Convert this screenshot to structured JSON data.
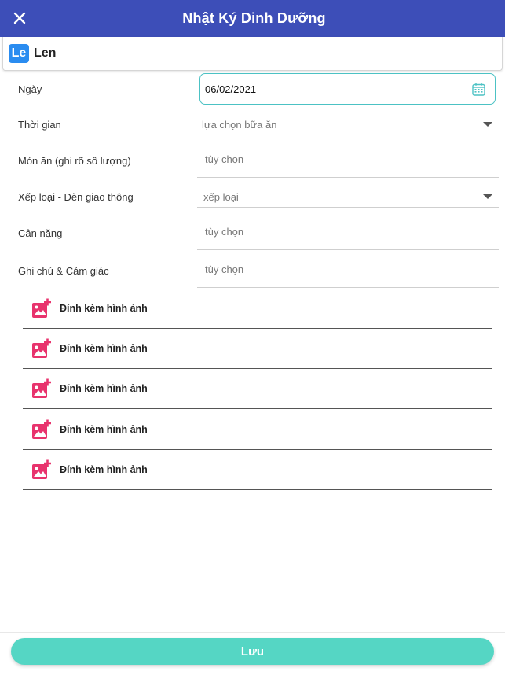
{
  "header": {
    "title": "Nhật Ký Dinh Dưỡng",
    "close_icon": "close-icon"
  },
  "profile": {
    "avatar_text": "Le",
    "name": "Len",
    "avatar_color": "#2a8cf0"
  },
  "form": {
    "date": {
      "label": "Ngày",
      "value": "06/02/2021",
      "icon": "calendar-icon"
    },
    "time": {
      "label": "Thời gian",
      "placeholder": "lựa chọn bữa ăn"
    },
    "food": {
      "label": "Món ăn (ghi rõ số lượng)",
      "placeholder": "tùy chọn"
    },
    "rating": {
      "label": "Xếp loại - Đèn giao thông",
      "placeholder": "xếp loại"
    },
    "weight": {
      "label": "Cân nặng",
      "placeholder": "tùy chọn"
    },
    "notes": {
      "label": "Ghi chú & Cảm giác",
      "placeholder": "tùy chọn"
    }
  },
  "attachments": [
    {
      "label": "Đính kèm hình ảnh",
      "icon": "add-photo-icon"
    },
    {
      "label": "Đính kèm hình ảnh",
      "icon": "add-photo-icon"
    },
    {
      "label": "Đính kèm hình ảnh",
      "icon": "add-photo-icon"
    },
    {
      "label": "Đính kèm hình ảnh",
      "icon": "add-photo-icon"
    },
    {
      "label": "Đính kèm hình ảnh",
      "icon": "add-photo-icon"
    }
  ],
  "save_button": {
    "label": "Lưu"
  },
  "colors": {
    "header": "#3d4eb8",
    "accent_teal": "#4cc2c4",
    "save_button": "#55d6c4",
    "attach_icon": "#e8336d"
  }
}
